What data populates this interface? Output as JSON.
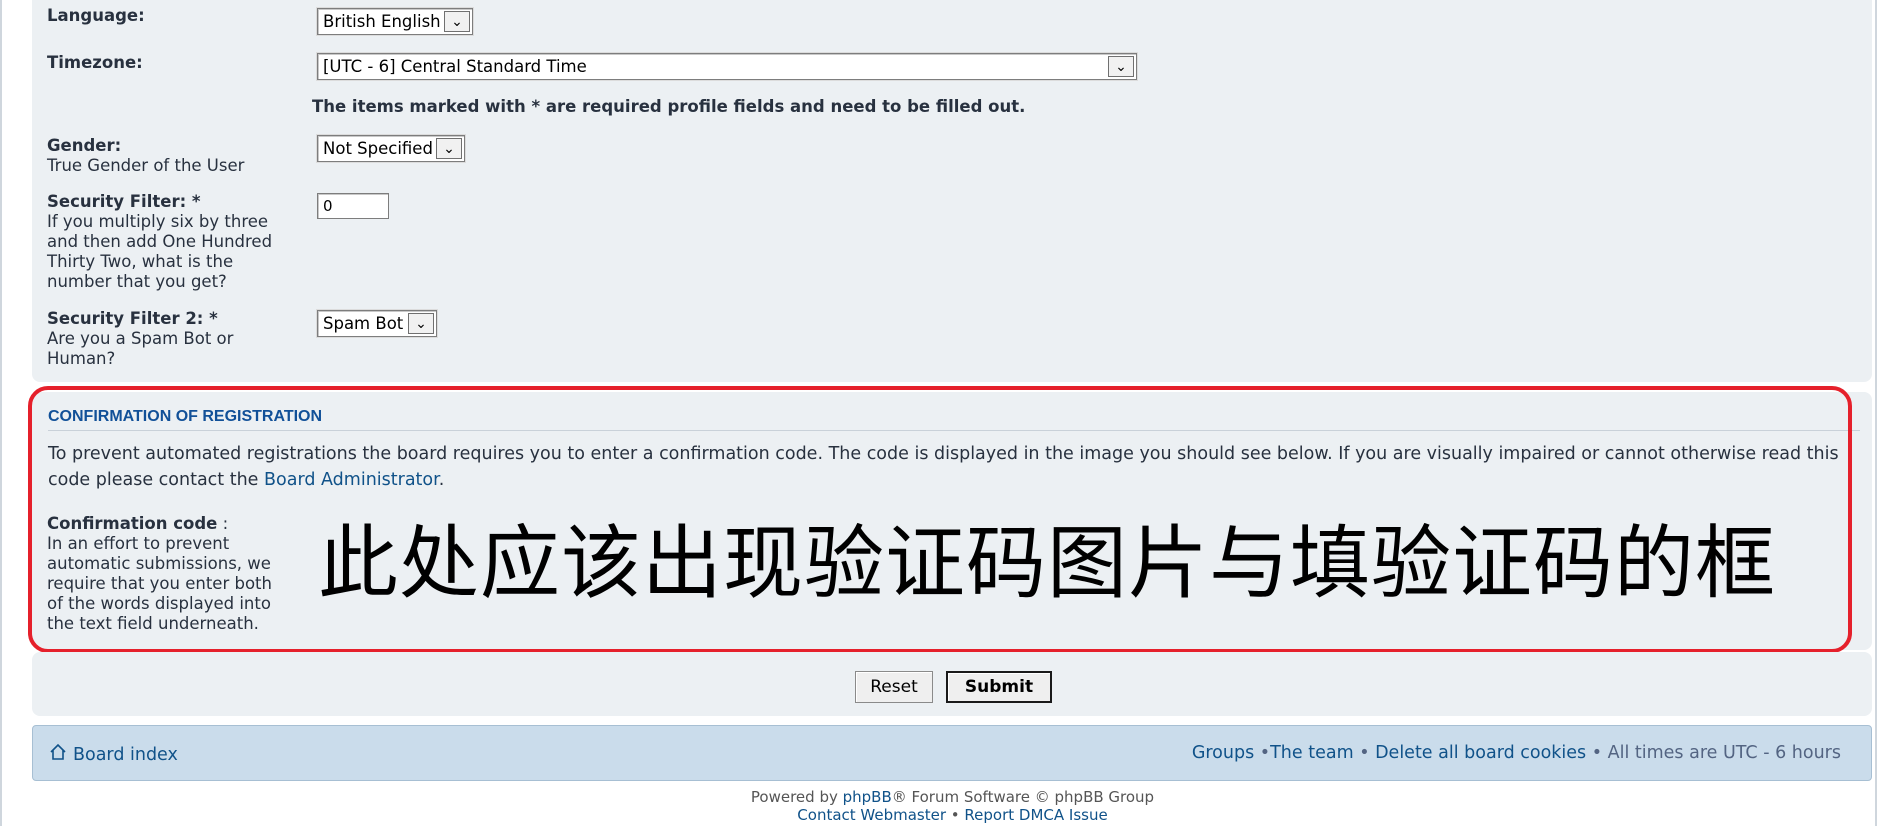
{
  "form": {
    "language": {
      "label": "Language:",
      "value": "British English"
    },
    "timezone": {
      "label": "Timezone:",
      "value": "[UTC - 6] Central Standard Time"
    },
    "required_note": "The items marked with * are required profile fields and need to be filled out.",
    "gender": {
      "label": "Gender:",
      "desc": "True Gender of the User",
      "value": "Not Specified"
    },
    "security1": {
      "label": "Security Filter: *",
      "desc_lines": [
        "If you multiply six by three",
        "and then add One Hundred",
        "Thirty Two, what is the",
        "number that you get?"
      ],
      "value": "0"
    },
    "security2": {
      "label": "Security Filter 2: *",
      "desc_lines": [
        "Are you a Spam Bot or",
        "Human?"
      ],
      "value": "Spam Bot"
    }
  },
  "confirm": {
    "title": "CONFIRMATION OF REGISTRATION",
    "text_before": "To prevent automated registrations the board requires you to enter a confirmation code. The code is displayed in the image you should see below. If you are visually impaired or cannot otherwise read this code please contact the ",
    "admin_link": "Board Administrator",
    "text_after": ".",
    "code_label": "Confirmation code",
    "code_colon": ":",
    "code_desc_lines": [
      "In an effort to prevent",
      "automatic submissions, we",
      "require that you enter both",
      "of the words displayed into",
      "the text field underneath."
    ],
    "overlay_text": "此处应该出现验证码图片与填验证码的框",
    "highlight_color": "#e5202b"
  },
  "buttons": {
    "reset": "Reset",
    "submit": "Submit"
  },
  "navbar": {
    "board_index": "Board index",
    "groups": "Groups",
    "sep1": " •",
    "team": "The team",
    "sep2": " • ",
    "delete_cookies": "Delete all board cookies",
    "times": " • All times are UTC - 6 hours"
  },
  "footer": {
    "powered_by": "Powered by ",
    "phpbb": "phpBB",
    "powered_rest": "® Forum Software © phpBB Group",
    "contact": "Contact Webmaster",
    "sep": " • ",
    "dmca": "Report DMCA Issue"
  },
  "colors": {
    "panel_bg": "#ecf0f3",
    "link": "#105289",
    "nav_bg": "#cadceb"
  }
}
